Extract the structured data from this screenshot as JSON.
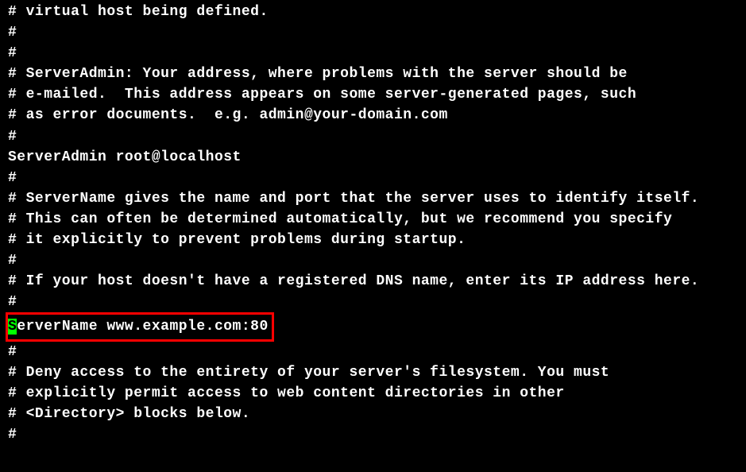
{
  "lines": {
    "l01": "# virtual host being defined.",
    "l02": "#",
    "l03": "",
    "l04": "#",
    "l05": "# ServerAdmin: Your address, where problems with the server should be",
    "l06": "# e-mailed.  This address appears on some server-generated pages, such",
    "l07": "# as error documents.  e.g. admin@your-domain.com",
    "l08": "#",
    "l09": "ServerAdmin root@localhost",
    "l10": "",
    "l11": "#",
    "l12": "# ServerName gives the name and port that the server uses to identify itself.",
    "l13": "# This can often be determined automatically, but we recommend you specify",
    "l14": "# it explicitly to prevent problems during startup.",
    "l15": "#",
    "l16": "# If your host doesn't have a registered DNS name, enter its IP address here.",
    "l17": "#",
    "highlighted_first": "S",
    "highlighted_rest": "erverName www.example.com:80",
    "l19": "",
    "l20": "#",
    "l21": "# Deny access to the entirety of your server's filesystem. You must",
    "l22": "# explicitly permit access to web content directories in other",
    "l23": "# <Directory> blocks below.",
    "l24": "#"
  }
}
